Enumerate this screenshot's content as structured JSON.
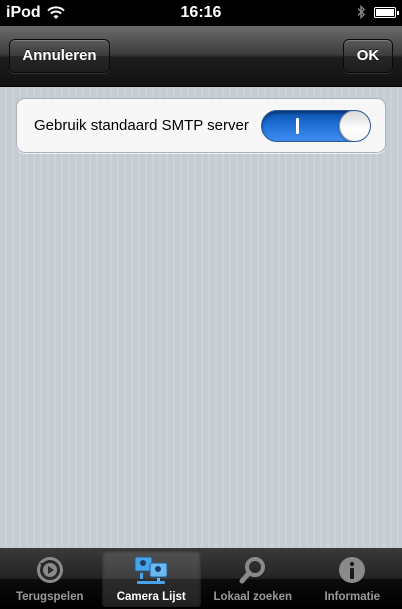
{
  "status_bar": {
    "carrier": "iPod",
    "time": "16:16"
  },
  "nav_bar": {
    "cancel_label": "Annuleren",
    "ok_label": "OK"
  },
  "settings": {
    "smtp_label": "Gebruik standaard SMTP server",
    "smtp_toggle_on": true
  },
  "tab_bar": {
    "tabs": [
      {
        "label": "Terugspelen",
        "icon": "replay-icon",
        "selected": false
      },
      {
        "label": "Camera Lijst",
        "icon": "camera-list-icon",
        "selected": true
      },
      {
        "label": "Lokaal zoeken",
        "icon": "search-icon",
        "selected": false
      },
      {
        "label": "Informatie",
        "icon": "info-icon",
        "selected": false
      }
    ]
  },
  "colors": {
    "toggle_on": "#1e6fd6",
    "background": "#c5ccd4"
  }
}
